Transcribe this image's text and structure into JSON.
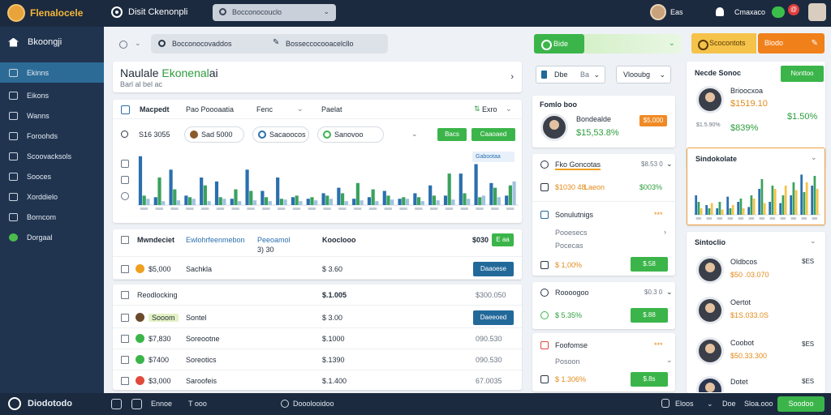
{
  "topbar": {
    "logo": "Flenalocele",
    "title": "Disit Ckenonpli",
    "search_placeholder": "Bocconocouclo",
    "user_count": "Eas",
    "user_name": "Cmaxaco",
    "badge": "@"
  },
  "sidebar": {
    "header": "Bkoongji",
    "items": [
      {
        "label": "Ekinns",
        "active": true
      },
      {
        "label": "Eikons"
      },
      {
        "label": "Wanns"
      },
      {
        "label": "Foroohds"
      },
      {
        "label": "Scoovacksols"
      },
      {
        "label": "Sooces"
      },
      {
        "label": "Xorddielo"
      },
      {
        "label": "Borncom"
      },
      {
        "label": "Dorgaal",
        "green": true
      }
    ]
  },
  "main": {
    "search_left": "Bocconocovaddos",
    "search_right": "Bosseccocooacelcllo",
    "title_main": "Naulale",
    "title_green": "Ekonenal",
    "title_tail": "ai",
    "subtitle": "Barl al bel ac",
    "chart_head": {
      "h1": "Macpedt",
      "h2": "Pao Poooaatia",
      "h3": "Fenc",
      "h4": "Paelat",
      "right": "Exro"
    },
    "chart_row": {
      "amount": "S16 3055",
      "pill1": "Sad 5000",
      "pill2": "Sacaoocos",
      "pill3": "Sanovoo",
      "btn1": "Bacs",
      "btn2": "Caaoaed"
    },
    "chart_legend": "Gabootaa",
    "table1": {
      "h1": "Mwndeciet",
      "h2": "Ewlohrfeenmebon",
      "h3": "Peeoamol",
      "h4": "Kooclooo",
      "h5": "$030",
      "h6": "E aa",
      "sub": "3) 30",
      "row": {
        "amt": "$5,000",
        "name": "Sachkla",
        "price": "$ 3.60",
        "btn": "Daaoese"
      }
    },
    "table2": {
      "head": "Reodlocking",
      "head_price": "$.1.005",
      "head_right": "$300.050",
      "rows": [
        {
          "tag": "Sooom",
          "name": "Sontel",
          "price": "$ 3.00",
          "right": "Daeeoed",
          "btn": true
        },
        {
          "tag": "$7,830",
          "name": "Soreootne",
          "price": "$.1000",
          "right": "090.530",
          "btn": false
        },
        {
          "tag": "$7400",
          "name": "Soreotics",
          "price": "$.1390",
          "right": "090.530",
          "btn": false
        },
        {
          "tag": "$3,000",
          "name": "Saroofeis",
          "price": "$.1.400",
          "right": "67.0035",
          "btn": false
        }
      ]
    }
  },
  "midcol": {
    "btn_green": "Bide",
    "select1": "Dbe",
    "select1_b": "Ba",
    "select2": "Vlooubg",
    "card1": {
      "title": "Fomlo boo",
      "name": "Bondealde",
      "value": "$15,53.8%",
      "badge": "$5,000"
    },
    "card2": {
      "title": "Fko Goncotas",
      "right": "$8.53 0",
      "amt1": "$1030 48.",
      "amt1b": "Laeon",
      "amt2": "$003%"
    },
    "card3": {
      "title": "Sonulutnigs",
      "stars": "***",
      "sub1": "Pooesecs",
      "sub2": "Pocecas",
      "amt": "$ 1,00%",
      "btn": "$.58"
    },
    "card4": {
      "title": "Roooogoo",
      "right": "$0.3 0",
      "amt": "$ 5.35%",
      "btn": "$.88"
    },
    "card5": {
      "title": "Foofomse",
      "stars": "***",
      "sub": "Posoon",
      "amt": "$ 1.306%",
      "btn": "$.8s"
    }
  },
  "rightcol": {
    "btn1": "Scocontots",
    "btn2": "Blodo",
    "btn_save": "Nonttoo",
    "card1": {
      "title": "Necde Sonoc",
      "name": "Brioocxoa",
      "val1": "$1519.10",
      "val2": "$1.5.90%",
      "val3": "$839%",
      "val4": "$1.50%"
    },
    "card2": {
      "title": "Sindokolate"
    },
    "card3": {
      "title": "Sintoclio",
      "people": [
        {
          "name": "Oldbcos",
          "val": "$50 .03.070",
          "right": "$ES"
        },
        {
          "name": "Oertot",
          "val": "$1S.033.0S",
          "right": ""
        },
        {
          "name": "Coobot",
          "val": "$50.33.300",
          "right": "$ES"
        },
        {
          "name": "Dotet",
          "val": "",
          "right": "$ES"
        }
      ]
    }
  },
  "bottombar": {
    "name": "Diodotodo",
    "item1": "Ennoe",
    "item2": "T ooo",
    "item3": "Dooolooidoo",
    "item4": "Eloos",
    "item5": "Doe",
    "item6": "Sloa.ooo",
    "btn": "Soodoo"
  },
  "chart_data": {
    "type": "bar",
    "series": [
      {
        "color": "#2b6fae",
        "values": [
          62,
          10,
          45,
          12,
          35,
          30,
          8,
          45,
          18,
          35,
          10,
          8,
          15,
          22,
          8,
          10,
          18,
          8,
          15,
          25,
          12,
          40,
          52,
          28,
          12
        ]
      },
      {
        "color": "#3aa25d",
        "values": [
          12,
          35,
          20,
          10,
          25,
          10,
          20,
          18,
          10,
          8,
          12,
          10,
          12,
          15,
          28,
          20,
          12,
          10,
          10,
          12,
          40,
          15,
          10,
          22,
          25
        ]
      },
      {
        "color": "#9fc3e0",
        "values": [
          8,
          5,
          6,
          8,
          5,
          8,
          5,
          6,
          5,
          7,
          5,
          6,
          8,
          5,
          6,
          5,
          7,
          8,
          5,
          6,
          7,
          8,
          12,
          10,
          30
        ]
      }
    ],
    "ylim": [
      0,
      70
    ]
  },
  "chart_data_right": {
    "type": "bar",
    "series": [
      {
        "color": "#2b6fae",
        "values": [
          30,
          15,
          10,
          28,
          20,
          12,
          40,
          20,
          18,
          30,
          62,
          45
        ]
      },
      {
        "color": "#3aa25d",
        "values": [
          20,
          10,
          20,
          10,
          25,
          30,
          55,
          45,
          30,
          50,
          35,
          60
        ]
      },
      {
        "color": "#f5c34a",
        "values": [
          10,
          18,
          8,
          15,
          10,
          25,
          18,
          40,
          45,
          38,
          50,
          40
        ]
      }
    ],
    "ylim": [
      0,
      70
    ]
  }
}
